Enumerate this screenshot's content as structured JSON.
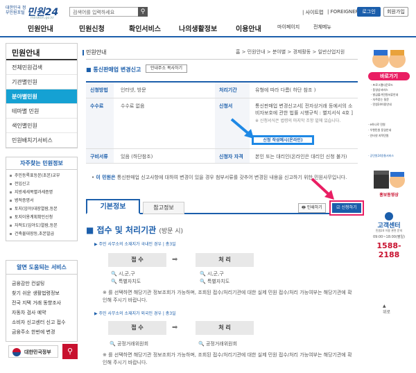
{
  "header": {
    "logo_gov": "대한민국 정부민원포털",
    "logo_name": "민원24",
    "logo_sub": "minwon.go.kr",
    "search_placeholder": "검색어를 입력하세요",
    "sitemap": "| 사이트맵",
    "foreigner": "| FOREIGNER",
    "login": "로그인",
    "join": "회원가입"
  },
  "nav": {
    "items": [
      "민원안내",
      "민원신청",
      "확인서비스",
      "나의생활정보",
      "이용안내"
    ],
    "mypage": "마이페이지",
    "all_menu": "전체메뉴"
  },
  "sidebar": {
    "title": "민원안내",
    "items": [
      "전체민원검색",
      "기관별민원",
      "분야별민원",
      "테마별 민원",
      "색인별민원",
      "민원배치기서비스"
    ],
    "active_index": 2,
    "freq_title": "자주찾는 민원정보",
    "freq_items": [
      "주민등록표등본(초본)교부",
      "전입신고",
      "지방세세목별과세증명",
      "병적증명서",
      "토지(임야)대장열람,등본",
      "토지이용계획확인신청",
      "자적도(임야도)열람,등본",
      "건축물대장등,초본발급"
    ],
    "svc_title": "알면 도움되는 서비스",
    "svc_items": [
      "금융감만 컨설팅",
      "찾기 쉬운 생활법령정보",
      "전국 지택 거래 동향조사",
      "자동차 검사 예약",
      "소비자 신고센터 신고 접수",
      "금융주소 한번에 변경"
    ],
    "gov_logo": "대한민국정부"
  },
  "content": {
    "page_title": "민원안내",
    "breadcrumb": "홈 > 민원안내 > 분야별 > 경제활동 > 일반산업지원",
    "sub_title": "통신판매업 변경신고",
    "copy_btn": "안내주소 복사하기",
    "table": {
      "h_method": "신청방법",
      "v_method": "인터넷, 방문",
      "h_period": "처리기간",
      "v_period": "유형에 따라 다름( 하단 참조 )",
      "h_fee": "수수료",
      "v_fee": "수수료 없음",
      "h_form": "신청서",
      "v_form": "통신판매업 변경신고서[ 전자상거래 등에서의 소비자보호에 관한 법률 시행규칙 : 별지서식 4호 ]",
      "v_form_note": "※ 신청서식은 법령의 마지막 조항 밑에 있습니다.",
      "h_docs": "구비서류",
      "v_docs": "있음 (하단참조)",
      "h_qual": "신청자 자격",
      "v_qual": "본인 또는 대리인(온라인은 대리인 신청 불가)"
    },
    "form_example": "신청 작성예시(온라인)",
    "intro": "이 민원은",
    "intro_text": " 통신판매업 신고사항에 대하여 변경이 있을 경우 첨부서류를 갖추어 변경된 내용을 신고하기 위한 민원사무입니다.",
    "tab_basic": "기본정보",
    "tab_ref": "참고정보",
    "print": "인쇄하기",
    "apply": "신청하기",
    "sec_title": "접수 및 처리기관",
    "sec_sub": "(방문 시)",
    "case1": "주민 사무소의 소재지가 국내인 경우 | 총3일",
    "case1_receive": "접 수",
    "case1_process": "처 리",
    "case1_r_office1": "시,군,구",
    "case1_r_office2": "특별자치도",
    "case1_p_office1": "시,군,구",
    "case1_p_office2": "특별자치도",
    "case1_note": "※ 를 선택하면 해당기관 정보조회가 가능하며, 조회된 접수/처리기관에 대한 실제 민원 접수/처리 가능여부는 해당기관에 확인해 주시기 바랍니다.",
    "case2": "주민 사무소의 소재지가 외국인 경우 | 총3일",
    "case2_r_office": "공정거래위원회",
    "case2_p_office": "공정거래위원회",
    "case2_note": "※ 를 선택하면 해당기관 정보조회가 가능하며, 조회된 접수/처리기관에 대한 실제 민원 접수/처리 가능여부는 해당기관에 확인해 주시기 바랍니다."
  },
  "right": {
    "quick_title": "바로가기",
    "quick_items": [
      "· 프로그램다운로드",
      "· 동영상서비스",
      "· 발급불가민원서류안내",
      "· 자주묻는 질문",
      "· 민원24이용안내"
    ],
    "links": [
      "· e하나로 민원",
      "· 우편민원 동일안내",
      "· 인터넷 지적민원"
    ],
    "gongmin": "· 공민원24용통서비스",
    "promo": "홍보동영상",
    "center_title": "고객센터",
    "center_sub": "민원24 이용 관련 문의",
    "center_hours": "09:00~18:00(평일)",
    "center_phone": "1588-2188",
    "top": "위로"
  }
}
